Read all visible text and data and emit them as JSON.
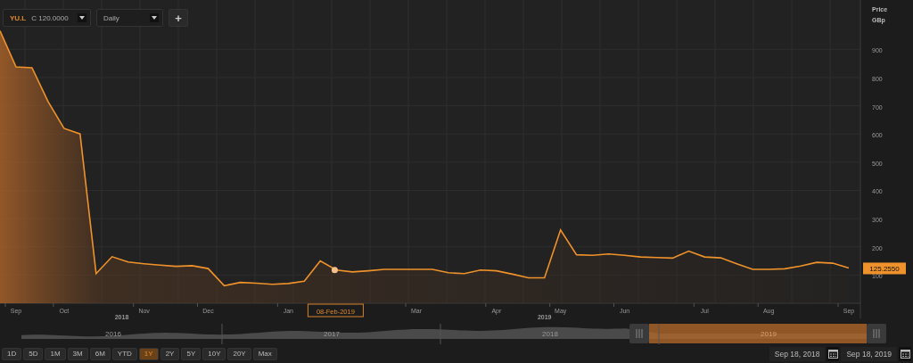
{
  "toolbar": {
    "symbol": "YU.L",
    "quote": "C 120.0000",
    "interval": "Daily",
    "add_button": "+"
  },
  "chart": {
    "last_value": "125.2550",
    "unit": "GBp",
    "year_labels": [
      "2018",
      "2019"
    ],
    "cursor_label": "08-Feb-2019",
    "chart_data": {
      "type": "area",
      "ylabel": "Price",
      "grid": true,
      "categories": [
        null,
        "Sep",
        null,
        null,
        "Oct",
        null,
        null,
        null,
        null,
        "Nov",
        null,
        null,
        null,
        "Dec",
        null,
        null,
        null,
        null,
        "Jan",
        null,
        null,
        null,
        null,
        null,
        null,
        null,
        "Mar",
        null,
        null,
        null,
        null,
        "Apr",
        null,
        null,
        null,
        "May",
        null,
        null,
        null,
        "Jun",
        null,
        null,
        null,
        null,
        "Jul",
        null,
        null,
        null,
        "Aug",
        null,
        null,
        null,
        null,
        "Sep"
      ],
      "series": [
        {
          "color": "#f0922b",
          "values": [
            966,
            838,
            835,
            715,
            620,
            600,
            105,
            165,
            146,
            140,
            135,
            131,
            133,
            123,
            62,
            74,
            71,
            67,
            70,
            78,
            150,
            118,
            111,
            115,
            120,
            120,
            120,
            120,
            108,
            105,
            118,
            115,
            103,
            90,
            90,
            260,
            172,
            170,
            175,
            170,
            164,
            162,
            160,
            185,
            164,
            161,
            140,
            120,
            120,
            122,
            132,
            145,
            142,
            125
          ]
        }
      ],
      "ylim": [
        0,
        1075
      ],
      "yticks": [
        100,
        200,
        300,
        400,
        500,
        600,
        700,
        800,
        900
      ]
    }
  },
  "navigator": {
    "years": [
      {
        "label": "2016",
        "selected": false
      },
      {
        "label": "2017",
        "selected": false
      },
      {
        "label": "2018",
        "selected": false
      },
      {
        "label": "2019",
        "selected": true
      }
    ]
  },
  "ranges": [
    {
      "label": "1D",
      "selected": false
    },
    {
      "label": "5D",
      "selected": false
    },
    {
      "label": "1M",
      "selected": false
    },
    {
      "label": "3M",
      "selected": false
    },
    {
      "label": "6M",
      "selected": false
    },
    {
      "label": "YTD",
      "selected": false
    },
    {
      "label": "1Y",
      "selected": true
    },
    {
      "label": "2Y",
      "selected": false
    },
    {
      "label": "5Y",
      "selected": false
    },
    {
      "label": "10Y",
      "selected": false
    },
    {
      "label": "20Y",
      "selected": false
    },
    {
      "label": "Max",
      "selected": false
    }
  ],
  "dates": {
    "from": "Sep 18, 2018",
    "to": "Sep 18, 2019"
  }
}
